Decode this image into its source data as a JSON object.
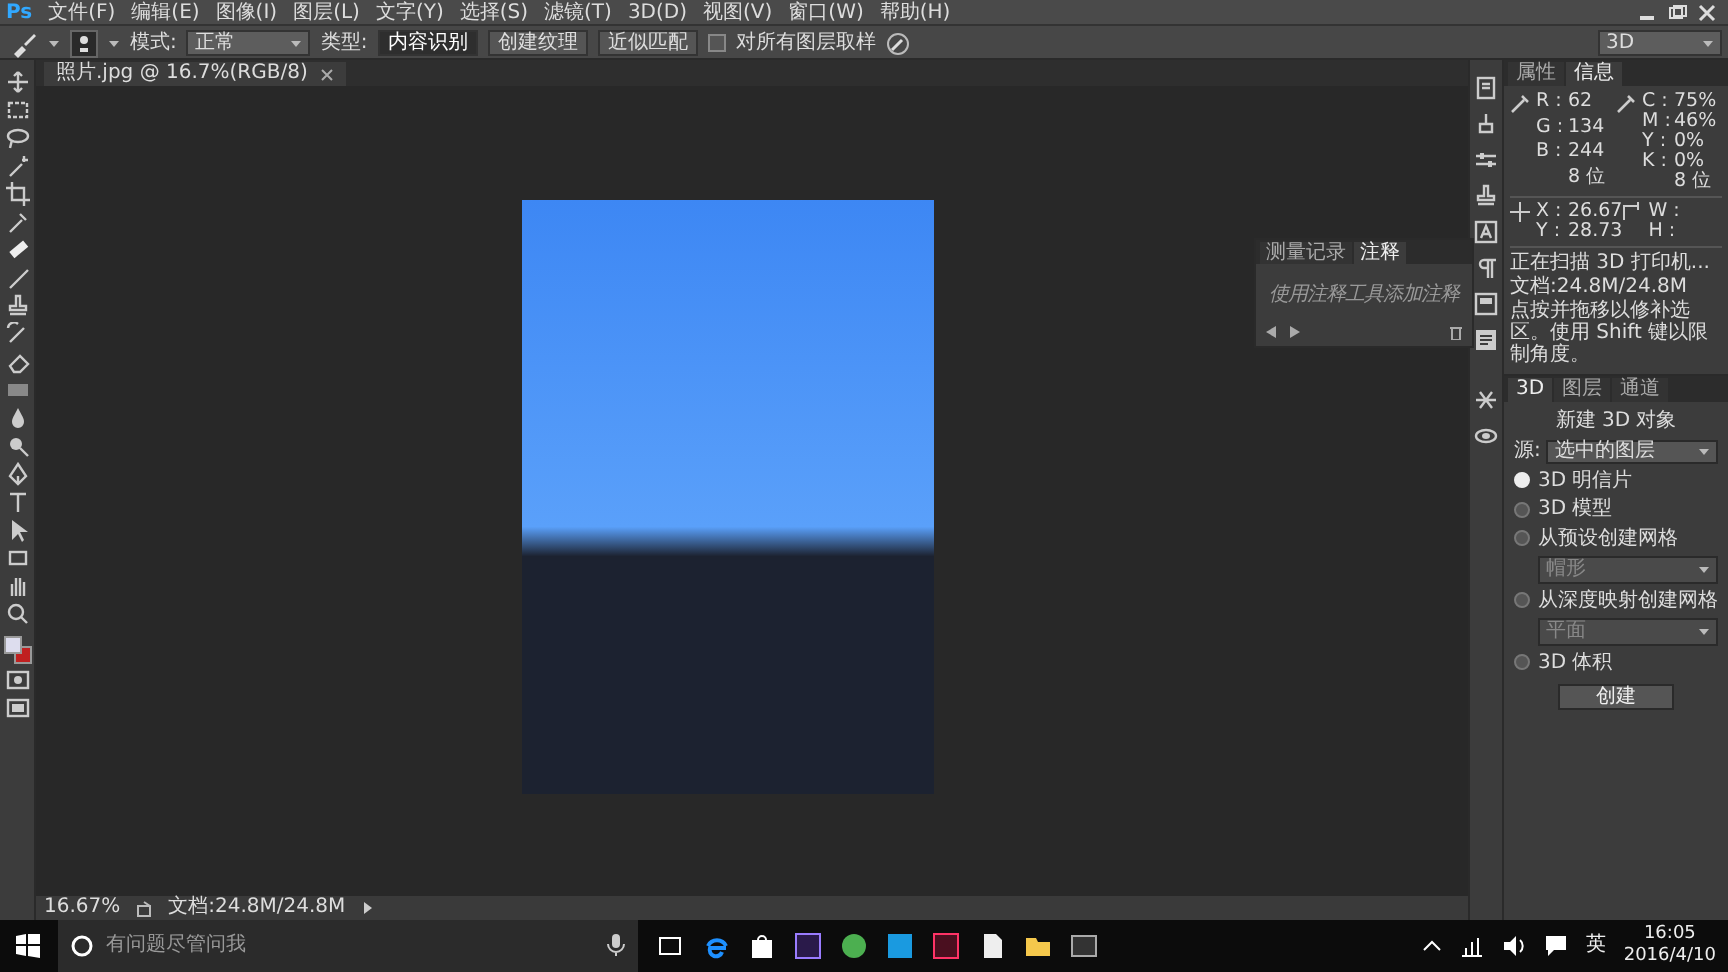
{
  "menu_bar": {
    "logo": "Ps",
    "items": [
      "文件(F)",
      "编辑(E)",
      "图像(I)",
      "图层(L)",
      "文字(Y)",
      "选择(S)",
      "滤镜(T)",
      "3D(D)",
      "视图(V)",
      "窗口(W)",
      "帮助(H)"
    ]
  },
  "options_bar": {
    "mode_label": "模式:",
    "mode_value": "正常",
    "type_label": "类型:",
    "types": [
      {
        "label": "内容识别",
        "selected": true
      },
      {
        "label": "创建纹理",
        "selected": false
      },
      {
        "label": "近似匹配",
        "selected": false
      }
    ],
    "sample_all": {
      "label": "对所有图层取样",
      "checked": false
    },
    "workspace": "3D"
  },
  "document": {
    "tab_title": "照片.jpg @ 16.7%(RGB/8)",
    "zoom": "16.67%",
    "doc_size": "文档:24.8M/24.8M"
  },
  "info_panel": {
    "tabs": [
      {
        "label": "属性",
        "selected": false
      },
      {
        "label": "信息",
        "selected": true
      }
    ],
    "rgb": [
      {
        "label": "R :",
        "value": "62"
      },
      {
        "label": "G :",
        "value": "134"
      },
      {
        "label": "B :",
        "value": "244"
      }
    ],
    "cmyk": [
      {
        "label": "C :",
        "value": "75%"
      },
      {
        "label": "M :",
        "value": "46%"
      },
      {
        "label": "Y :",
        "value": "0%"
      },
      {
        "label": "K :",
        "value": "0%"
      }
    ],
    "bit_depth": [
      "8 位",
      "8 位"
    ],
    "position": [
      {
        "label": "X :",
        "value": "26.67"
      },
      {
        "label": "Y :",
        "value": "28.73"
      }
    ],
    "size": [
      {
        "label": "W :"
      },
      {
        "label": "H :"
      }
    ],
    "messages": [
      "正在扫描 3D 打印机...",
      "文档:24.8M/24.8M",
      "点按并拖移以修补选区。使用 Shift 键以限制角度。"
    ]
  },
  "notes_panel": {
    "tabs": [
      {
        "label": "测量记录",
        "selected": false
      },
      {
        "label": "注释",
        "selected": true
      }
    ],
    "hint": "使用注释工具添加注释"
  },
  "panel_3d": {
    "tabs": [
      {
        "label": "3D",
        "selected": true
      },
      {
        "label": "图层",
        "selected": false
      },
      {
        "label": "通道",
        "selected": false
      }
    ],
    "heading": "新建 3D 对象",
    "source_label": "源:",
    "source_value": "选中的图层",
    "options": [
      {
        "kind": "radio",
        "label": "3D 明信片",
        "selected": true
      },
      {
        "kind": "radio",
        "label": "3D 模型",
        "selected": false
      },
      {
        "kind": "radio",
        "label": "从预设创建网格",
        "selected": false
      },
      {
        "kind": "select",
        "value": "帽形"
      },
      {
        "kind": "radio",
        "label": "从深度映射创建网格",
        "selected": false
      },
      {
        "kind": "select",
        "value": "平面"
      },
      {
        "kind": "radio",
        "label": "3D 体积",
        "selected": false
      }
    ],
    "create_button": "创建"
  },
  "taskbar": {
    "search_placeholder": "有问题尽管问我",
    "language": "英",
    "time": "16:05",
    "date": "2016/4/10"
  }
}
